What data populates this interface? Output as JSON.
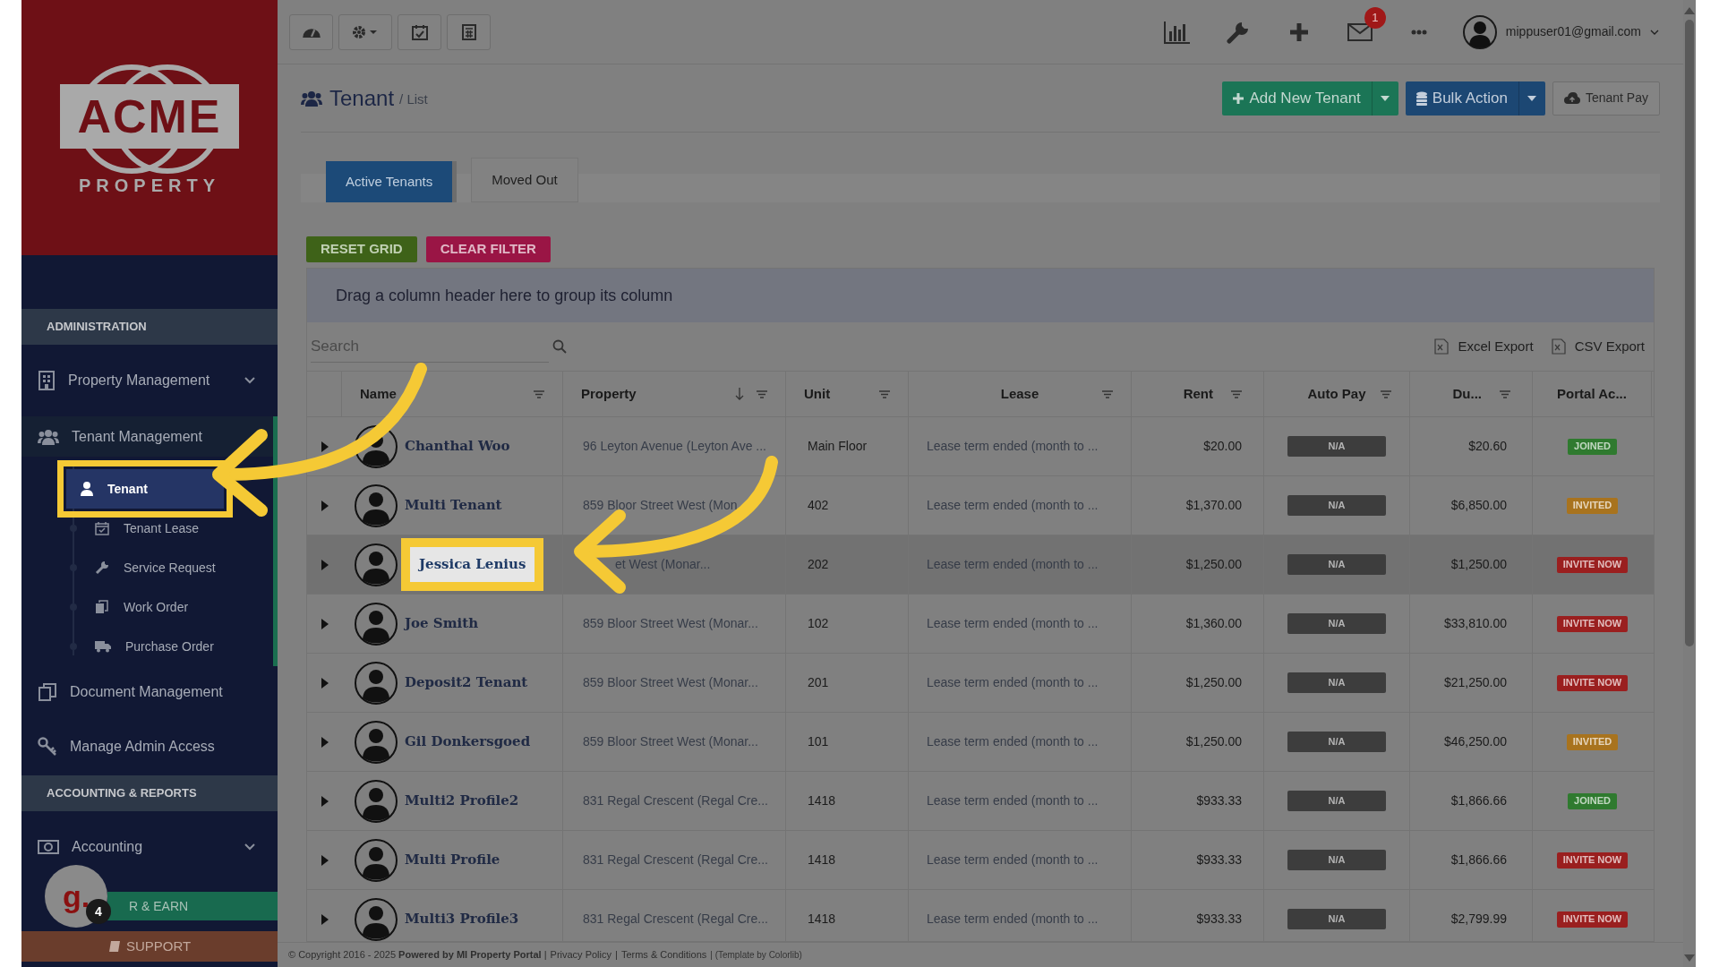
{
  "sidebar": {
    "logo": {
      "word": "ACME",
      "subtitle": "PROPERTY"
    },
    "sections": [
      {
        "title": "ADMINISTRATION",
        "items": [
          {
            "label": "Property Management",
            "expanded": false,
            "selected": false
          },
          {
            "label": "Tenant Management",
            "expanded": true,
            "selected": true,
            "children": [
              {
                "label": "Tenant",
                "selected": true,
                "highlighted": true
              },
              {
                "label": "Tenant Lease",
                "selected": false,
                "highlighted": false
              },
              {
                "label": "Service Request",
                "selected": false,
                "highlighted": false
              },
              {
                "label": "Work Order",
                "selected": false,
                "highlighted": false
              },
              {
                "label": "Purchase Order",
                "selected": false,
                "highlighted": false
              }
            ]
          },
          {
            "label": "Document Management",
            "selected": false
          },
          {
            "label": "Manage Admin Access",
            "selected": false
          }
        ]
      },
      {
        "title": "ACCOUNTING & REPORTS",
        "items": [
          {
            "label": "Accounting",
            "expanded": false,
            "selected": false
          }
        ]
      }
    ],
    "refer": "R & EARN",
    "support": "SUPPORT",
    "chat": {
      "letter": "g.",
      "badge": "4"
    }
  },
  "topbar": {
    "mail_badge": "1",
    "user": "mippuser01@gmail.com"
  },
  "page": {
    "title": "Tenant",
    "breadcrumb": "/ List",
    "actions": [
      {
        "label": "Add New Tenant",
        "kind": "add"
      },
      {
        "label": "Bulk Action",
        "kind": "bulk"
      },
      {
        "label": "Tenant Pay",
        "kind": "pay"
      }
    ]
  },
  "tabs": [
    {
      "label": "Active Tenants",
      "selected": true
    },
    {
      "label": "Moved Out",
      "selected": false
    }
  ],
  "grid_buttons": [
    {
      "label": "RESET GRID",
      "kind": "reset"
    },
    {
      "label": "CLEAR FILTER",
      "kind": "clear"
    }
  ],
  "group_panel": "Drag a column header here to group its column",
  "search": {
    "placeholder": "Search"
  },
  "exports": [
    "Excel Export",
    "CSV Export"
  ],
  "table": {
    "columns": [
      {
        "label": "Name"
      },
      {
        "label": "Property",
        "sorted": true
      },
      {
        "label": "Unit"
      },
      {
        "label": "Lease"
      },
      {
        "label": "Rent"
      },
      {
        "label": "Auto Pay"
      },
      {
        "label": "Du..."
      },
      {
        "label": "Portal Ac..."
      }
    ],
    "rows": [
      {
        "name": "Chanthal Woo",
        "property": "96 Leyton Avenue (Leyton Ave ...",
        "unit": "Main Floor",
        "lease": "Lease term ended (month to ...",
        "rent": "$20.00",
        "auto_pay": "N/A",
        "due": "$20.60",
        "portal": "JOINED",
        "color": "#2f7a2f",
        "highlighted": false
      },
      {
        "name": "Multi Tenant",
        "property": "859 Bloor Street West (Mon",
        "unit": "402",
        "lease": "Lease term ended (month to ...",
        "rent": "$1,370.00",
        "auto_pay": "N/A",
        "due": "$6,850.00",
        "portal": "INVITED",
        "color": "#a8731e",
        "highlighted": false
      },
      {
        "name": "Jessica Lenius",
        "property": "et West (Monar...",
        "unit": "202",
        "lease": "Lease term ended (month to ...",
        "rent": "$1,250.00",
        "auto_pay": "N/A",
        "due": "$1,250.00",
        "portal": "INVITE NOW",
        "color": "#9a1f1f",
        "highlighted": true
      },
      {
        "name": "Joe Smith",
        "property": "859 Bloor Street West (Monar...",
        "unit": "102",
        "lease": "Lease term ended (month to ...",
        "rent": "$1,360.00",
        "auto_pay": "N/A",
        "due": "$33,810.00",
        "portal": "INVITE NOW",
        "color": "#9a1f1f",
        "highlighted": false
      },
      {
        "name": "Deposit2 Tenant",
        "property": "859 Bloor Street West (Monar...",
        "unit": "201",
        "lease": "Lease term ended (month to ...",
        "rent": "$1,250.00",
        "auto_pay": "N/A",
        "due": "$21,250.00",
        "portal": "INVITE NOW",
        "color": "#9a1f1f",
        "highlighted": false
      },
      {
        "name": "Gil Donkersgoed",
        "property": "859 Bloor Street West (Monar...",
        "unit": "101",
        "lease": "Lease term ended (month to ...",
        "rent": "$1,250.00",
        "auto_pay": "N/A",
        "due": "$46,250.00",
        "portal": "INVITED",
        "color": "#a8731e",
        "highlighted": false
      },
      {
        "name": "Multi2 Profile2",
        "property": "831 Regal Crescent (Regal Cre...",
        "unit": "1418",
        "lease": "Lease term ended (month to ...",
        "rent": "$933.33",
        "auto_pay": "N/A",
        "due": "$1,866.66",
        "portal": "JOINED",
        "color": "#2f7a2f",
        "highlighted": false
      },
      {
        "name": "Multi Profile",
        "property": "831 Regal Crescent (Regal Cre...",
        "unit": "1418",
        "lease": "Lease term ended (month to ...",
        "rent": "$933.33",
        "auto_pay": "N/A",
        "due": "$1,866.66",
        "portal": "INVITE NOW",
        "color": "#9a1f1f",
        "highlighted": false
      },
      {
        "name": "Multi3 Profile3",
        "property": "831 Regal Crescent (Regal Cre...",
        "unit": "1418",
        "lease": "Lease term ended (month to ...",
        "rent": "$933.33",
        "auto_pay": "N/A",
        "due": "$2,799.99",
        "portal": "INVITE NOW",
        "color": "#9a1f1f",
        "highlighted": false
      }
    ]
  },
  "footer": {
    "text": "© Copyright 2016 - 2025 **Powered by MI Property Portal** |",
    "links": [
      "Privacy Policy",
      "Terms & Conditions"
    ],
    "separator": "|",
    "credit": "| (Template by Colorlib)"
  }
}
